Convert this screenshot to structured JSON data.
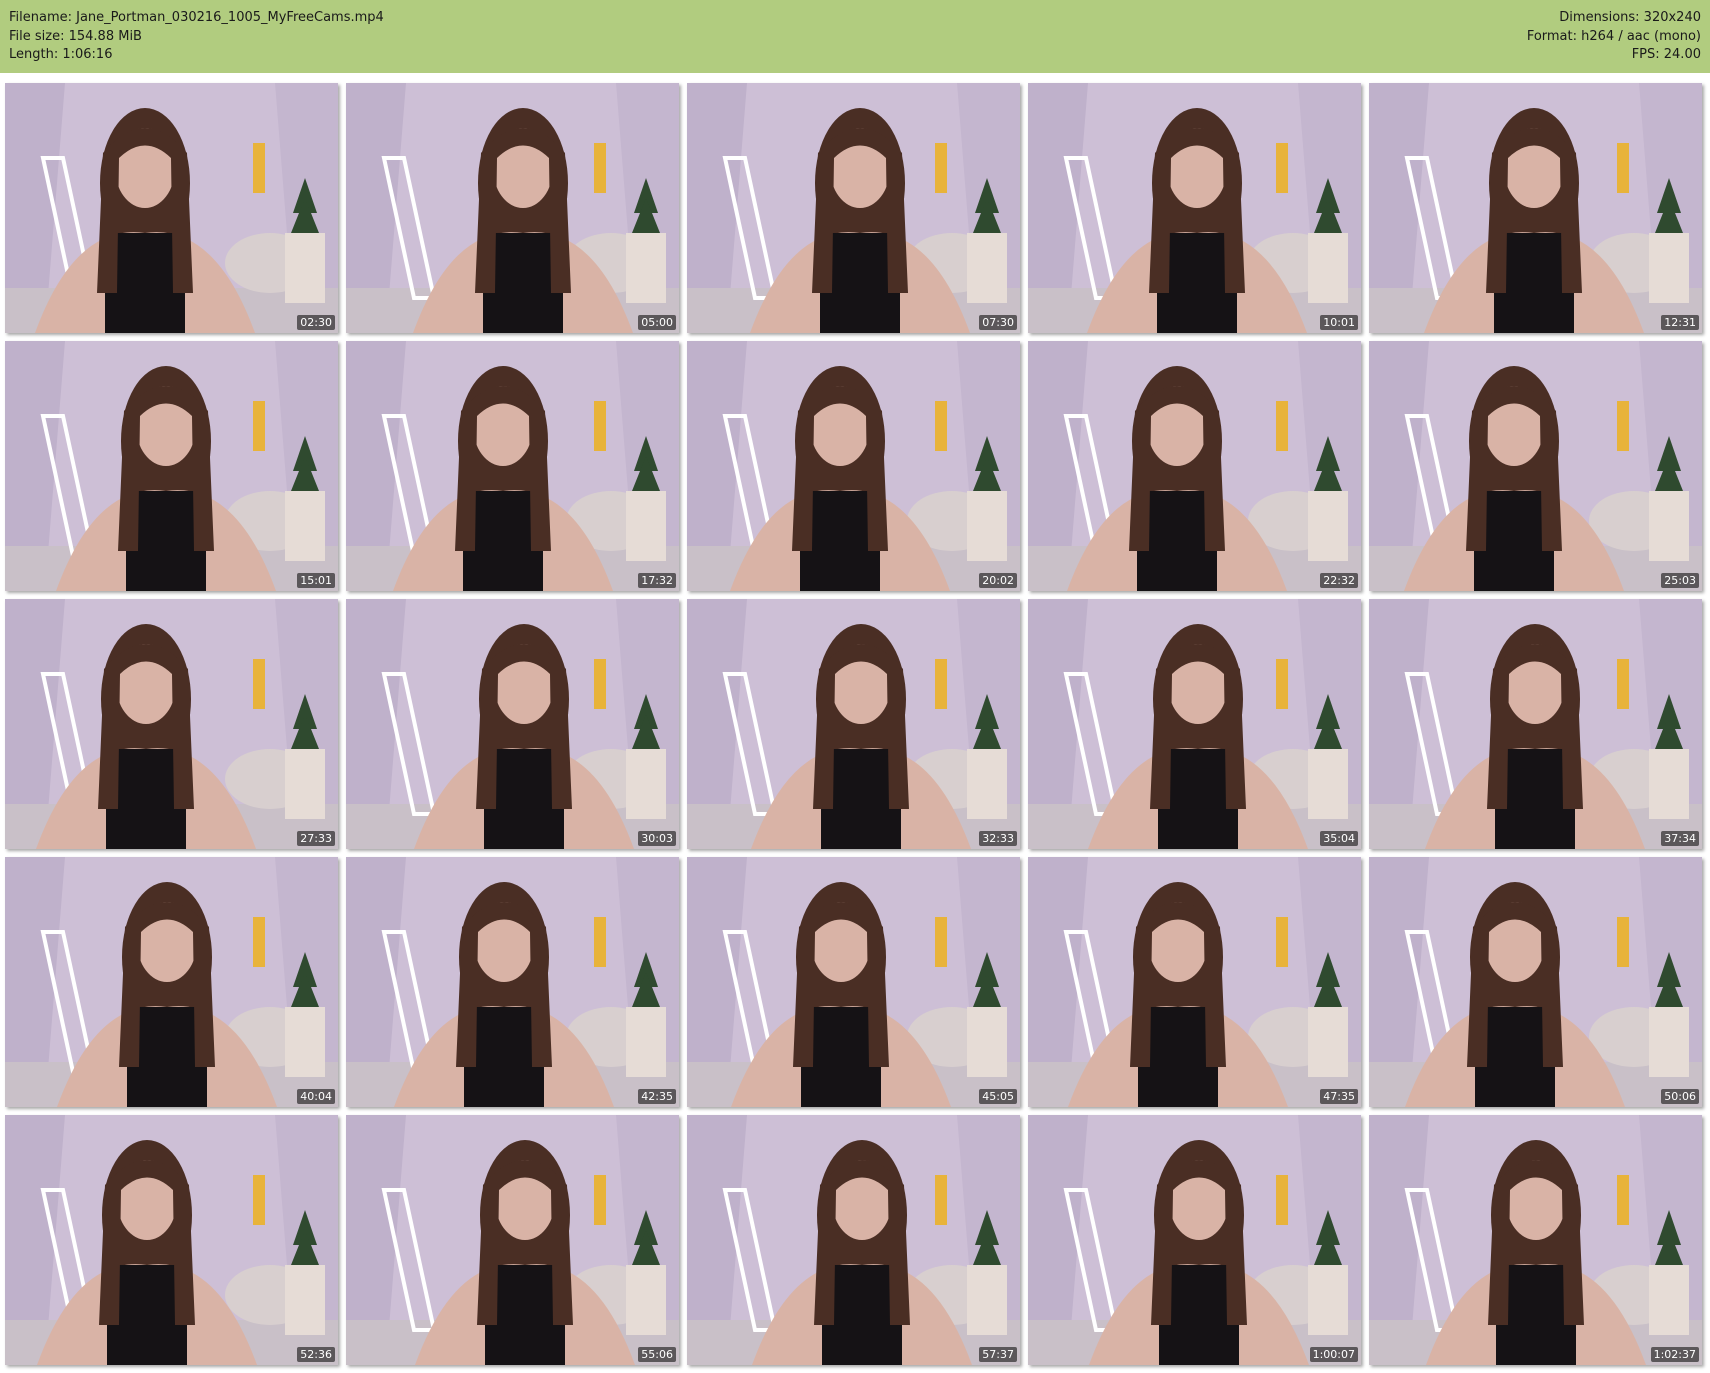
{
  "header": {
    "filename": "Filename: Jane_Portman_030216_1005_MyFreeCams.mp4",
    "filesize": "File size: 154.88 MiB",
    "length": "Length: 1:06:16",
    "dimensions": "Dimensions: 320x240",
    "format": "Format: h264 / aac (mono)",
    "fps": "FPS: 24.00"
  },
  "colors": {
    "header_bg": "#b1cc7f",
    "wall": "#cdbfd6",
    "floor": "#c9c0c8",
    "lamp": "#e8b33a",
    "hair": "#4a2e24",
    "skin": "#d9b3a6",
    "top": "#151215"
  },
  "thumbnails": [
    {
      "time": "02:30"
    },
    {
      "time": "05:00"
    },
    {
      "time": "07:30"
    },
    {
      "time": "10:01"
    },
    {
      "time": "12:31"
    },
    {
      "time": "15:01"
    },
    {
      "time": "17:32"
    },
    {
      "time": "20:02"
    },
    {
      "time": "22:32"
    },
    {
      "time": "25:03"
    },
    {
      "time": "27:33"
    },
    {
      "time": "30:03"
    },
    {
      "time": "32:33"
    },
    {
      "time": "35:04"
    },
    {
      "time": "37:34"
    },
    {
      "time": "40:04"
    },
    {
      "time": "42:35"
    },
    {
      "time": "45:05"
    },
    {
      "time": "47:35"
    },
    {
      "time": "50:06"
    },
    {
      "time": "52:36"
    },
    {
      "time": "55:06"
    },
    {
      "time": "57:37"
    },
    {
      "time": "1:00:07"
    },
    {
      "time": "1:02:37"
    }
  ]
}
